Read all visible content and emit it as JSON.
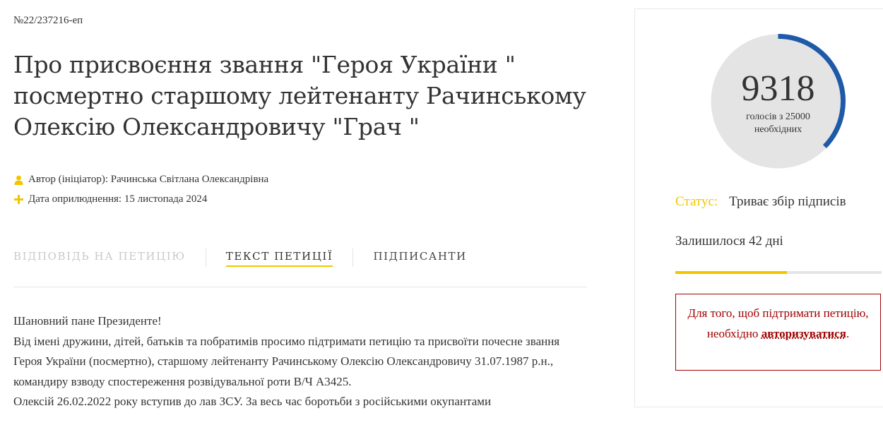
{
  "petition": {
    "number": "№22/237216-еп",
    "title": "Про присвоєння звання \"Героя України \" посмертно старшому лейтенанту Рачинському Олексію Олександровичу \"Грач \"",
    "author_label": "Автор (ініціатор):",
    "author_name": "Рачинська Світлана Олександрівна",
    "date_label": "Дата оприлюднення:",
    "date_value": "15 листопада 2024"
  },
  "tabs": [
    {
      "label": "ВІДПОВІДЬ НА ПЕТИЦІЮ",
      "state": "disabled"
    },
    {
      "label": "ТЕКСТ ПЕТИЦІЇ",
      "state": "active"
    },
    {
      "label": "ПІДПИСАНТИ",
      "state": "normal"
    }
  ],
  "body": {
    "greeting": "Шановний пане Президенте!",
    "paragraph1": "Від імені дружини, дітей, батьків та побратимів просимо підтримати петицію та присвоїти почесне звання Героя України (посмертно), старшому лейтенанту Рачинському Олексію Олександровичу 31.07.1987 р.н., командиру взводу спостереження розвідувальної роти В/Ч А3425.",
    "paragraph2": "Олексій 26.02.2022 року вступив до лав ЗСУ. За весь час боротьби з російськими окупантами"
  },
  "sidebar": {
    "votes": "9318",
    "votes_caption": "голосів з 25000 необхідних",
    "votes_count": 9318,
    "votes_required": 25000,
    "status_label": "Статус:",
    "status_value": "Триває збір підписів",
    "remaining": "Залишилося 42 дні",
    "time_progress": 0.54,
    "auth_text_before": "Для того, щоб підтримати петицію, необхідно",
    "auth_link": "авторизуватися",
    "auth_text_after": "."
  },
  "colors": {
    "accent": "#f2c500",
    "counter_arc": "#1e5aa8",
    "counter_bg": "#e4e4e4",
    "alert": "#a00000"
  }
}
